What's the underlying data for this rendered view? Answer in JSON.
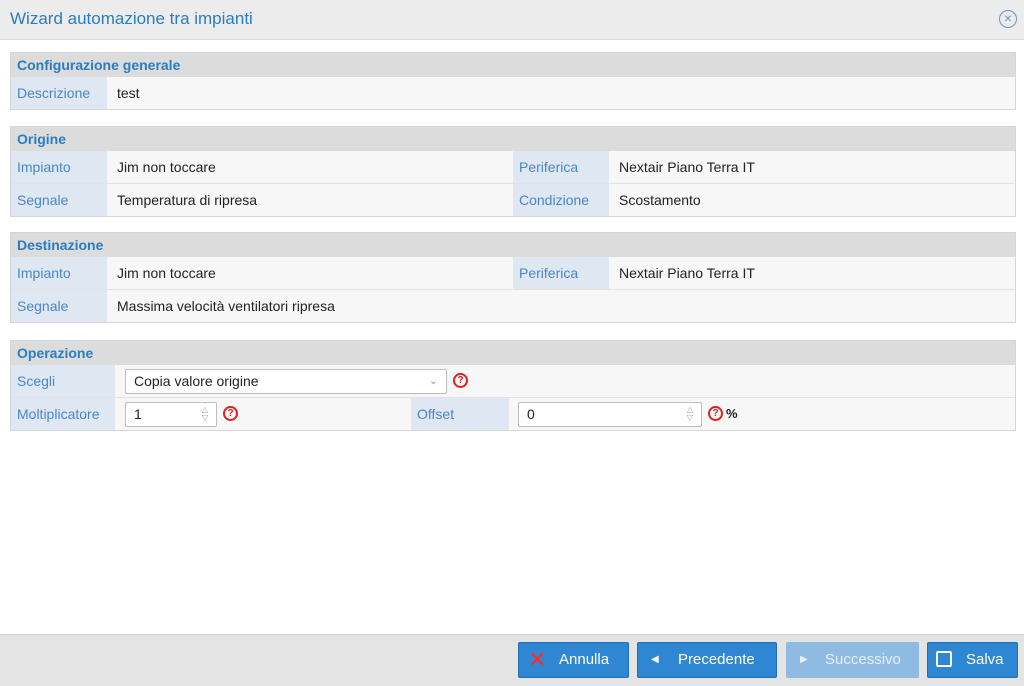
{
  "window": {
    "title": "Wizard automazione tra impianti",
    "close_icon": "close-circle-icon"
  },
  "general": {
    "title": "Configurazione generale",
    "descrizione_label": "Descrizione",
    "descrizione_value": "test"
  },
  "origine": {
    "title": "Origine",
    "impianto_label": "Impianto",
    "impianto_value": "Jim non toccare",
    "periferica_label": "Periferica",
    "periferica_value": "Nextair Piano Terra IT",
    "segnale_label": "Segnale",
    "segnale_value": "Temperatura di ripresa",
    "condizione_label": "Condizione",
    "condizione_value": "Scostamento"
  },
  "destinazione": {
    "title": "Destinazione",
    "impianto_label": "Impianto",
    "impianto_value": "Jim non toccare",
    "periferica_label": "Periferica",
    "periferica_value": "Nextair Piano Terra IT",
    "segnale_label": "Segnale",
    "segnale_value": "Massima velocità ventilatori ripresa"
  },
  "operazione": {
    "title": "Operazione",
    "scegli_label": "Scegli",
    "scegli_value": "Copia valore origine",
    "moltiplicatore_label": "Moltiplicatore",
    "moltiplicatore_value": "1",
    "offset_label": "Offset",
    "offset_value": "0",
    "offset_unit": "%"
  },
  "footer": {
    "annulla": "Annulla",
    "precedente": "Precedente",
    "successivo": "Successivo",
    "salva": "Salva"
  },
  "colors": {
    "accent": "#2a7dc0",
    "button": "#2f87d3",
    "danger": "#e02020"
  }
}
